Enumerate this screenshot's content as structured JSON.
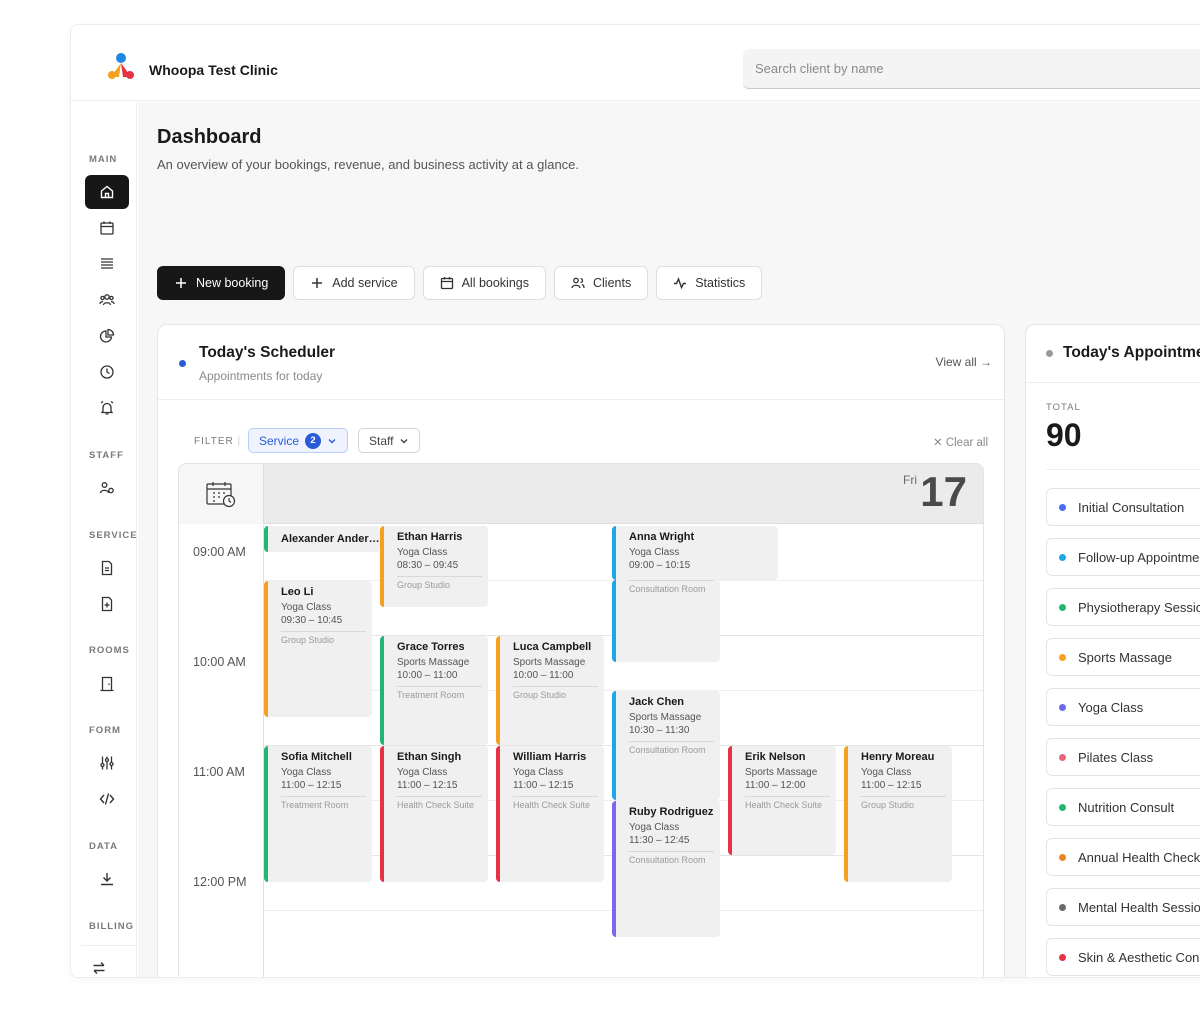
{
  "app": {
    "clinic_name": "Whoopa Test Clinic"
  },
  "search": {
    "placeholder": "Search client by name"
  },
  "sidebar": {
    "sections": [
      "MAIN",
      "STAFF",
      "SERVICE",
      "ROOMS",
      "FORM",
      "DATA",
      "BILLING"
    ]
  },
  "page": {
    "title": "Dashboard",
    "subtitle": "An overview of your bookings, revenue, and business activity at a glance."
  },
  "actions": {
    "new_booking": "New booking",
    "add_service": "Add service",
    "all_bookings": "All bookings",
    "clients": "Clients",
    "statistics": "Statistics"
  },
  "scheduler": {
    "title": "Today's Scheduler",
    "subtitle": "Appointments for today",
    "view_all": "View all →",
    "filter_label": "FILTER",
    "service_filter": "Service",
    "service_count": "2",
    "staff_filter": "Staff",
    "clear_all": "✕ Clear all",
    "day_name": "Fri",
    "day_num": "17",
    "times": [
      "09:00 AM",
      "10:00 AM",
      "11:00 AM",
      "12:00 PM"
    ],
    "events": [
      {
        "name": "Alexander Anderson",
        "service": "",
        "time": "",
        "room": "",
        "color": "#22b573"
      },
      {
        "name": "Leo Li",
        "service": "Yoga Class",
        "time": "09:30 – 10:45",
        "room": "Group Studio",
        "color": "#f5a11f"
      },
      {
        "name": "Sofia Mitchell",
        "service": "Yoga Class",
        "time": "11:00 – 12:15",
        "room": "Treatment Room",
        "color": "#22b573"
      },
      {
        "name": "Ethan Harris",
        "service": "Yoga Class",
        "time": "08:30 – 09:45",
        "room": "Group Studio",
        "color": "#f5a11f"
      },
      {
        "name": "Grace Torres",
        "service": "Sports Massage",
        "time": "10:00 – 11:00",
        "room": "Treatment Room",
        "color": "#22b573"
      },
      {
        "name": "Ethan Singh",
        "service": "Yoga Class",
        "time": "11:00 – 12:15",
        "room": "Health Check Suite",
        "color": "#e53245"
      },
      {
        "name": "Luca Campbell",
        "service": "Sports Massage",
        "time": "10:00 – 11:00",
        "room": "Group Studio",
        "color": "#f5a11f"
      },
      {
        "name": "William Harris",
        "service": "Yoga Class",
        "time": "11:00 – 12:15",
        "room": "Health Check Suite",
        "color": "#e53245"
      },
      {
        "name": "Anna Wright",
        "service": "Yoga Class",
        "time": "09:00 – 10:15",
        "room": "Consultation Room",
        "color": "#1ea7e8"
      },
      {
        "name": "Jack Chen",
        "service": "Sports Massage",
        "time": "10:30 – 11:30",
        "room": "Consultation Room",
        "color": "#1ea7e8"
      },
      {
        "name": "Ruby Rodriguez",
        "service": "Yoga Class",
        "time": "11:30 – 12:45",
        "room": "Consultation Room",
        "color": "#7b68ee"
      },
      {
        "name": "Erik Nelson",
        "service": "Sports Massage",
        "time": "11:00 – 12:00",
        "room": "Health Check Suite",
        "color": "#e53245"
      },
      {
        "name": "Henry Moreau",
        "service": "Yoga Class",
        "time": "11:00 – 12:15",
        "room": "Group Studio",
        "color": "#f5a11f"
      }
    ]
  },
  "appointments": {
    "title": "Today's Appointments",
    "total_label": "TOTAL",
    "total_value": "90",
    "services": [
      {
        "label": "Initial Consultation",
        "color": "#4a6cf0"
      },
      {
        "label": "Follow-up Appointment",
        "color": "#1ea7e8"
      },
      {
        "label": "Physiotherapy Session",
        "color": "#22b573"
      },
      {
        "label": "Sports Massage",
        "color": "#f5a11f"
      },
      {
        "label": "Yoga Class",
        "color": "#6a6ae8"
      },
      {
        "label": "Pilates Class",
        "color": "#e8677a"
      },
      {
        "label": "Nutrition Consult",
        "color": "#22b573"
      },
      {
        "label": "Annual Health Check",
        "color": "#e8861f"
      },
      {
        "label": "Mental Health Session",
        "color": "#6a6a6a"
      },
      {
        "label": "Skin & Aesthetic Consult",
        "color": "#e53245"
      }
    ]
  }
}
